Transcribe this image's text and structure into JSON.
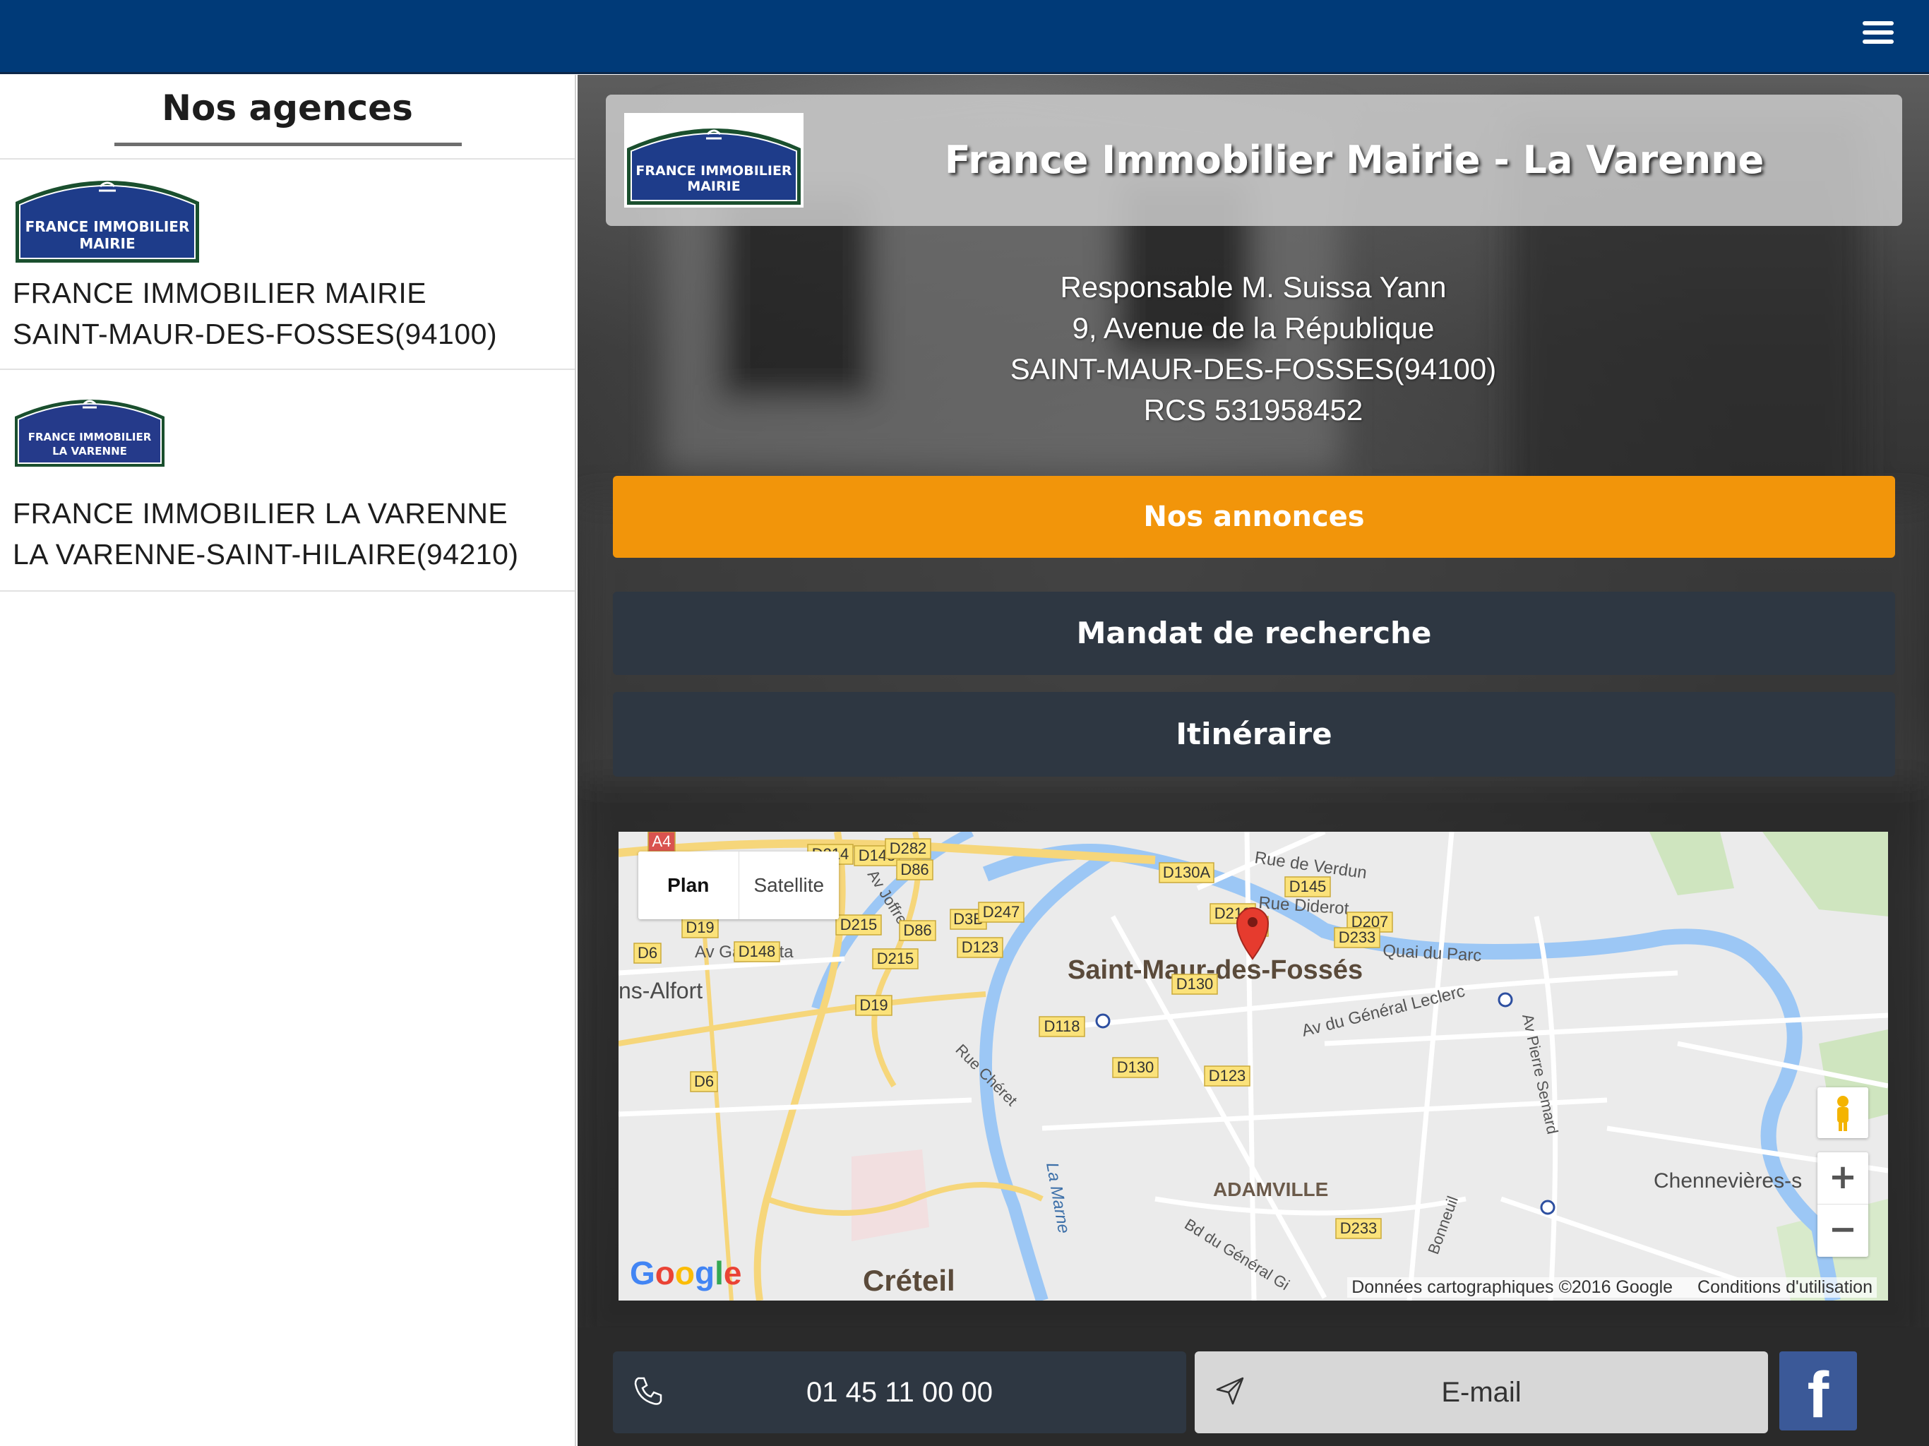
{
  "left": {
    "title": "Nos agences",
    "agencies": [
      {
        "line1": "FRANCE IMMOBILIER MAIRIE",
        "line2": "SAINT-MAUR-DES-FOSSES(94100)",
        "logo_text1": "FRANCE IMMOBILIER",
        "logo_text2": "MAIRIE"
      },
      {
        "line1": "FRANCE IMMOBILIER LA VARENNE",
        "line2": "LA VARENNE-SAINT-HILAIRE(94210)",
        "logo_text1": "FRANCE IMMOBILIER",
        "logo_text2": "LA VARENNE"
      }
    ]
  },
  "header": {
    "title": "France Immobilier Mairie - La Varenne",
    "logo_text1": "FRANCE IMMOBILIER",
    "logo_text2": "MAIRIE"
  },
  "info": {
    "responsable": "Responsable M. Suissa Yann",
    "address": "9, Avenue de la République",
    "city": "SAINT-MAUR-DES-FOSSES(94100)",
    "rcs": "RCS 531958452"
  },
  "buttons": {
    "annonces": "Nos annonces",
    "mandat": "Mandat de recherche",
    "itineraire": "Itinéraire"
  },
  "map": {
    "toggle_plan": "Plan",
    "toggle_satellite": "Satellite",
    "zoom_in": "+",
    "zoom_out": "−",
    "attribution": "Données cartographiques ©2016 Google",
    "terms": "Conditions d'utilisation",
    "google": "Google",
    "labels": {
      "city_main": "Saint-Maur-des-Fossés",
      "creteil": "Créteil",
      "adamville": "ADAMVILLE",
      "chennevieres": "Chennevières-s",
      "alfort": "ns-Alfort",
      "rue_verdun": "Rue de Verdun",
      "rue_diderot": "Rue Diderot",
      "quai_parc": "Quai du Parc",
      "av_gambetta": "Av Gambetta",
      "av_joffre": "Av Joffre",
      "rue_cheret": "Rue Chéret",
      "av_leclerc": "Av du Général Leclerc",
      "av_semard": "Av Pierre Semard",
      "la_marne": "La Marne",
      "bd_general": "Bd du Général Gi",
      "bonneuil": "Bonneuil"
    },
    "roads": [
      "D214",
      "D148",
      "D282",
      "D86",
      "D130A",
      "D145",
      "D19",
      "D215",
      "D86",
      "D3B",
      "D247",
      "D219",
      "D4",
      "D207",
      "D233",
      "D6",
      "D148",
      "D215",
      "D123",
      "D130",
      "D19",
      "D118",
      "D233",
      "D6",
      "D130",
      "D123",
      "A4"
    ]
  },
  "bottom": {
    "phone": "01 45 11 00 00",
    "email": "E-mail",
    "facebook": "f"
  },
  "colors": {
    "topbar": "#003a78",
    "accent_orange": "#f2950a",
    "dark_button": "#2e3742",
    "facebook": "#3b5998"
  }
}
